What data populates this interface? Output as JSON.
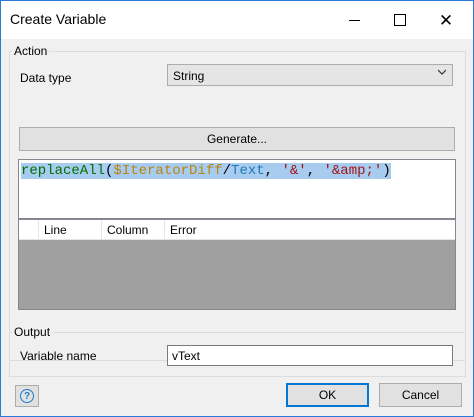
{
  "window": {
    "title": "Create Variable"
  },
  "action": {
    "legend": "Action",
    "data_type_label": "Data type",
    "data_type_value": "String",
    "generate_label": "Generate..."
  },
  "expression": {
    "fn": "replaceAll",
    "open": "(",
    "var": "$IteratorDiff",
    "slash": "/",
    "attr": "Text",
    "comma1": ", ",
    "arg1": "'&'",
    "comma2": ", ",
    "arg2": "'&amp;'",
    "close": ")"
  },
  "errors_table": {
    "columns": [
      "Line",
      "Column",
      "Error"
    ],
    "rows": []
  },
  "output": {
    "legend": "Output",
    "variable_name_label": "Variable name",
    "variable_name_value": "vText"
  },
  "buttons": {
    "help_glyph": "?",
    "ok": "OK",
    "cancel": "Cancel"
  },
  "colors": {
    "accent": "#0078d7",
    "window_border": "#2b79d8",
    "selection": "#a8cbf0"
  },
  "icons": [
    "minimize-icon",
    "maximize-icon",
    "close-icon",
    "chevron-down-icon",
    "help-icon"
  ]
}
